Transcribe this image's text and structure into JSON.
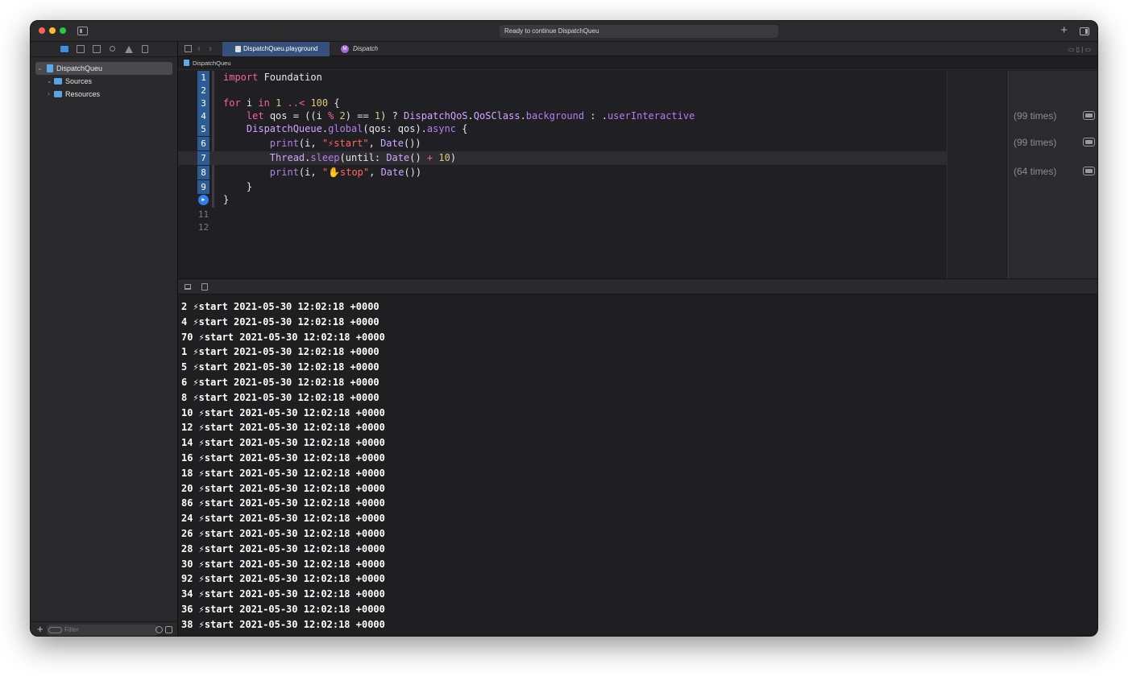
{
  "window": {
    "status_text": "Ready to continue DispatchQueu"
  },
  "tabs": [
    {
      "label": "DispatchQueu.playground",
      "icon": "playground-file-icon",
      "active": true
    },
    {
      "label": "Dispatch",
      "icon": "module-icon",
      "icon_letter": "M",
      "active": false
    }
  ],
  "jumpbar": {
    "label": "DispatchQueu"
  },
  "navigator": {
    "items": [
      {
        "label": "DispatchQueu",
        "kind": "playground",
        "expanded": true,
        "selected": true
      },
      {
        "label": "Sources",
        "kind": "folder",
        "expanded": true
      },
      {
        "label": "Resources",
        "kind": "folder",
        "expanded": false
      }
    ],
    "filter_placeholder": "Filter"
  },
  "editor": {
    "line_numbers": [
      "1",
      "2",
      "3",
      "4",
      "5",
      "6",
      "7",
      "8",
      "9",
      "10",
      "11",
      "12"
    ],
    "current_line": 7,
    "run_line": 10
  },
  "results": [
    {
      "line": 4,
      "label": "(99 times)"
    },
    {
      "line": 6,
      "label": "(99 times)"
    },
    {
      "line": 8,
      "label": "(64 times)"
    }
  ],
  "console": {
    "lines": [
      "2 ⚡start 2021-05-30 12:02:18 +0000",
      "4 ⚡start 2021-05-30 12:02:18 +0000",
      "70 ⚡start 2021-05-30 12:02:18 +0000",
      "1 ⚡start 2021-05-30 12:02:18 +0000",
      "5 ⚡start 2021-05-30 12:02:18 +0000",
      "6 ⚡start 2021-05-30 12:02:18 +0000",
      "8 ⚡start 2021-05-30 12:02:18 +0000",
      "10 ⚡start 2021-05-30 12:02:18 +0000",
      "12 ⚡start 2021-05-30 12:02:18 +0000",
      "14 ⚡start 2021-05-30 12:02:18 +0000",
      "16 ⚡start 2021-05-30 12:02:18 +0000",
      "18 ⚡start 2021-05-30 12:02:18 +0000",
      "20 ⚡start 2021-05-30 12:02:18 +0000",
      "86 ⚡start 2021-05-30 12:02:18 +0000",
      "24 ⚡start 2021-05-30 12:02:18 +0000",
      "26 ⚡start 2021-05-30 12:02:18 +0000",
      "28 ⚡start 2021-05-30 12:02:18 +0000",
      "30 ⚡start 2021-05-30 12:02:18 +0000",
      "92 ⚡start 2021-05-30 12:02:18 +0000",
      "34 ⚡start 2021-05-30 12:02:18 +0000",
      "36 ⚡start 2021-05-30 12:02:18 +0000",
      "38 ⚡start 2021-05-30 12:02:18 +0000"
    ]
  },
  "colors": {
    "accent": "#2f7ded",
    "keyword": "#fc5fa3",
    "number": "#d9c97c",
    "function": "#b281eb",
    "string": "#fc6a5d"
  }
}
